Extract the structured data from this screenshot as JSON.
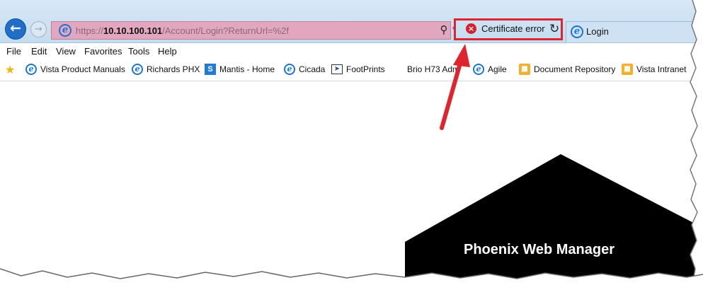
{
  "browser": {
    "url_prefix": "https://",
    "url_host": "10.10.100.101",
    "url_path": "/Account/Login?ReturnUrl=%2f",
    "certificate_error_label": "Certificate error",
    "tab_label": "Login"
  },
  "menu": [
    "File",
    "Edit",
    "View",
    "Favorites",
    "Tools",
    "Help"
  ],
  "favorites": [
    {
      "label": "Vista Product Manuals",
      "icon": "ie-icon"
    },
    {
      "label": "Richards PHX",
      "icon": "ie-icon"
    },
    {
      "label": "Mantis - Home",
      "icon": "sharepoint-icon"
    },
    {
      "label": "Cicada",
      "icon": "ie-icon"
    },
    {
      "label": "FootPrints",
      "icon": "footprints-icon"
    },
    {
      "label": "Brio H73 Adm",
      "icon": "none"
    },
    {
      "label": "Agile",
      "icon": "ie-icon"
    },
    {
      "label": "Document Repository",
      "icon": "folder-icon"
    },
    {
      "label": "Vista Intranet",
      "icon": "folder-icon"
    }
  ],
  "page": {
    "brand_title": "Phoenix Web Manager"
  },
  "colors": {
    "address_bar_error": "#e2a6bf",
    "highlight_red": "#e0242d",
    "logo_black": "#000000"
  }
}
